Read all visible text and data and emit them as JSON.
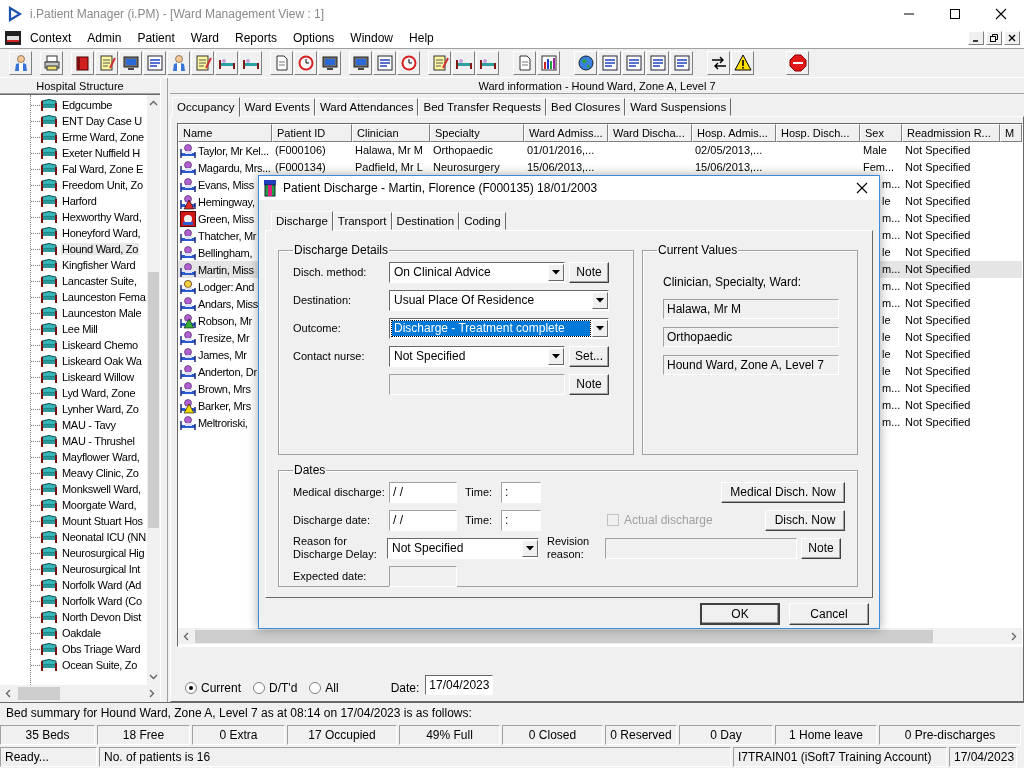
{
  "window": {
    "title": "i.Patient Manager (i.PM) - [Ward Management View : 1]"
  },
  "menu": [
    "Context",
    "Admin",
    "Patient",
    "Ward",
    "Reports",
    "Options",
    "Window",
    "Help"
  ],
  "sidebar": {
    "title": "Hospital Structure",
    "items": [
      {
        "label": "Edgcumbe",
        "selected": false
      },
      {
        "label": "ENT Day Case U",
        "selected": false
      },
      {
        "label": "Erme Ward, Zone",
        "selected": false
      },
      {
        "label": "Exeter Nuffield H",
        "selected": false
      },
      {
        "label": "Fal Ward, Zone E",
        "selected": false
      },
      {
        "label": "Freedom Unit, Zo",
        "selected": false
      },
      {
        "label": "Harford",
        "selected": false
      },
      {
        "label": "Hexworthy Ward,",
        "selected": false
      },
      {
        "label": "Honeyford Ward,",
        "selected": false
      },
      {
        "label": "Hound Ward, Zo",
        "selected": true
      },
      {
        "label": "Kingfisher Ward",
        "selected": false
      },
      {
        "label": "Lancaster Suite,",
        "selected": false
      },
      {
        "label": "Launceston Fema",
        "selected": false
      },
      {
        "label": "Launceston Male",
        "selected": false
      },
      {
        "label": "Lee Mill",
        "selected": false
      },
      {
        "label": "Liskeard Chemo",
        "selected": false
      },
      {
        "label": "Liskeard Oak Wa",
        "selected": false
      },
      {
        "label": "Liskeard Willow",
        "selected": false
      },
      {
        "label": "Lyd Ward, Zone",
        "selected": false
      },
      {
        "label": "Lynher Ward, Zo",
        "selected": false
      },
      {
        "label": "MAU - Tavy",
        "selected": false
      },
      {
        "label": "MAU - Thrushel",
        "selected": false
      },
      {
        "label": "Mayflower Ward,",
        "selected": false
      },
      {
        "label": "Meavy Clinic, Zo",
        "selected": false
      },
      {
        "label": "Monkswell Ward,",
        "selected": false
      },
      {
        "label": "Moorgate Ward,",
        "selected": false
      },
      {
        "label": "Mount Stuart Hos",
        "selected": false
      },
      {
        "label": "Neonatal ICU (NN",
        "selected": false
      },
      {
        "label": "Neurosurgical Hig",
        "selected": false
      },
      {
        "label": "Neurosurgical Int",
        "selected": false
      },
      {
        "label": "Norfolk Ward (Ad",
        "selected": false
      },
      {
        "label": "Norfolk Ward (Co",
        "selected": false
      },
      {
        "label": "North Devon Dist",
        "selected": false
      },
      {
        "label": "Oakdale",
        "selected": false
      },
      {
        "label": "Obs Triage Ward",
        "selected": false
      },
      {
        "label": "Ocean Suite, Zo",
        "selected": false
      }
    ]
  },
  "ward_info": {
    "title": "Ward information - Hound Ward, Zone A, Level 7"
  },
  "tabs": [
    {
      "label": "Occupancy",
      "selected": true
    },
    {
      "label": "Ward Events",
      "selected": false
    },
    {
      "label": "Ward Attendances",
      "selected": false
    },
    {
      "label": "Bed Transfer Requests",
      "selected": false
    },
    {
      "label": "Bed Closures",
      "selected": false
    },
    {
      "label": "Ward Suspensions",
      "selected": false
    }
  ],
  "table": {
    "columns": [
      "Name",
      "Patient ID",
      "Clinician",
      "Specialty",
      "Ward Admiss...",
      "Ward Discha...",
      "Hosp. Admis...",
      "Hosp. Disch...",
      "Sex",
      "Readmission R...",
      "M"
    ],
    "rows": [
      {
        "kind": "patient",
        "selected": false,
        "covered": false,
        "name": "Taylor, Mr Kel...",
        "patient_id": "(F000106)",
        "clinician": "Halawa, Mr M",
        "specialty": "Orthopaedic",
        "ward_admission": "01/01/2016,...",
        "hosp_admission": "02/05/2013,...",
        "sex": "Male",
        "readmission": "Not Specified"
      },
      {
        "kind": "patient",
        "selected": false,
        "covered": false,
        "name": "Magardu, Mrs...",
        "patient_id": "(F000134)",
        "clinician": "Padfield, Mr L",
        "specialty": "Neurosurgery",
        "ward_admission": "15/06/2013,...",
        "hosp_admission": "15/06/2013,...",
        "sex": "Fem...",
        "readmission": "Not Specified"
      },
      {
        "kind": "patient",
        "selected": false,
        "covered": true,
        "name": "Evans, Miss",
        "sex": "m...",
        "readmission": "Not Specified"
      },
      {
        "kind": "alert",
        "color": "#e02828",
        "selected": false,
        "covered": true,
        "name": "Hemingway,",
        "sex": "le",
        "readmission": "Not Specified"
      },
      {
        "kind": "stop",
        "selected": false,
        "covered": true,
        "name": "Green, Miss",
        "sex": "m...",
        "readmission": "Not Specified"
      },
      {
        "kind": "patient",
        "selected": false,
        "covered": true,
        "name": "Thatcher, Mr",
        "sex": "m...",
        "readmission": "Not Specified"
      },
      {
        "kind": "patient",
        "selected": false,
        "covered": true,
        "name": "Bellingham,",
        "sex": "le",
        "readmission": "Not Specified"
      },
      {
        "kind": "patient",
        "selected": true,
        "covered": true,
        "name": "Martin, Miss",
        "sex": "m...",
        "readmission": "Not Specified"
      },
      {
        "kind": "lodger",
        "selected": false,
        "covered": true,
        "name": "Lodger: And",
        "sex": "m...",
        "readmission": "Not Specified"
      },
      {
        "kind": "patient",
        "selected": false,
        "covered": true,
        "name": "Andars, Miss",
        "sex": "m...",
        "readmission": "Not Specified"
      },
      {
        "kind": "alert",
        "color": "#38b038",
        "selected": false,
        "covered": true,
        "name": "Robson, Mr",
        "sex": "le",
        "readmission": "Not Specified"
      },
      {
        "kind": "patient",
        "selected": false,
        "covered": true,
        "name": "Tresize, Mr",
        "sex": "le",
        "readmission": "Not Specified"
      },
      {
        "kind": "patient",
        "selected": false,
        "covered": true,
        "name": "James, Mr",
        "sex": "le",
        "readmission": "Not Specified"
      },
      {
        "kind": "patient",
        "selected": false,
        "covered": true,
        "name": "Anderton, Dr",
        "sex": "le",
        "readmission": "Not Specified"
      },
      {
        "kind": "patient",
        "selected": false,
        "covered": true,
        "name": "Brown, Mrs",
        "sex": "m...",
        "readmission": "Not Specified"
      },
      {
        "kind": "alert",
        "color": "#f0d800",
        "selected": false,
        "covered": true,
        "name": "Barker, Mrs",
        "sex": "m...",
        "readmission": "Not Specified"
      },
      {
        "kind": "patient",
        "selected": false,
        "covered": true,
        "name": "Meltroriski,",
        "sex": "m...",
        "readmission": "Not Specified"
      }
    ]
  },
  "filter": {
    "options": [
      {
        "label": "Current",
        "selected": true
      },
      {
        "label": "D/T'd",
        "selected": false
      },
      {
        "label": "All",
        "selected": false
      }
    ],
    "date_label": "Date:",
    "date_value": "17/04/2023"
  },
  "dialog": {
    "title": "Patient Discharge - Martin, Florence (F000135) 18/01/2003",
    "tabs": [
      {
        "label": "Discharge",
        "selected": true
      },
      {
        "label": "Transport",
        "selected": false
      },
      {
        "label": "Destination",
        "selected": false
      },
      {
        "label": "Coding",
        "selected": false
      }
    ],
    "discharge_details": {
      "title": "Discharge Details",
      "fields": [
        {
          "kind": "select",
          "label": "Disch. method:",
          "value": "On Clinical Advice",
          "button": "Note",
          "highlighted": false
        },
        {
          "kind": "wide",
          "label": "Destination:",
          "value": "Usual Place Of Residence",
          "highlighted": false
        },
        {
          "kind": "wide",
          "label": "Outcome:",
          "value": "Discharge - Treatment complete",
          "highlighted": true
        },
        {
          "kind": "select",
          "label": "Contact nurse:",
          "value": "Not Specified",
          "button": "Set...",
          "highlighted": false
        },
        {
          "kind": "text",
          "button": "Note",
          "disabled": true
        }
      ]
    },
    "current_values": {
      "title": "Current Values",
      "label": "Clinician, Specialty, Ward:",
      "values": [
        "Halawa, Mr M",
        "Orthopaedic",
        "Hound Ward, Zone A, Level 7"
      ]
    },
    "dates": {
      "title": "Dates",
      "medical_discharge": {
        "label": "Medical discharge:",
        "value": "/ /",
        "time_label": "Time:",
        "time_value": ":",
        "button": "Medical Disch. Now"
      },
      "discharge_date": {
        "label": "Discharge date:",
        "value": "/ /",
        "time_label": "Time:",
        "time_value": ":",
        "button": "Disch. Now"
      },
      "actual_discharge": {
        "label": "Actual discharge",
        "checked": false,
        "disabled": true
      },
      "delay_reason": {
        "label": "Reason for Discharge Delay:",
        "value": "Not Specified"
      },
      "revision_reason": {
        "label": "Revision reason:",
        "button": "Note",
        "disabled": true
      },
      "expected_date": {
        "label": "Expected date:",
        "disabled": true
      }
    },
    "buttons": [
      "OK",
      "Cancel"
    ]
  },
  "bed_summary": {
    "text": "Bed summary for Hound Ward, Zone A, Level 7 as at 08:14 on 17/04/2023 is as follows:",
    "stats": [
      "35 Beds",
      "18 Free",
      "0 Extra",
      "17 Occupied",
      "49% Full",
      "0 Closed",
      "0 Reserved",
      "0 Day",
      "1 Home leave",
      "0 Pre-discharges"
    ]
  },
  "status_bar": [
    "Ready...",
    "No. of patients is 16",
    "I7TRAIN01 (iSoft7 Training Account)",
    "17/04/2023"
  ]
}
